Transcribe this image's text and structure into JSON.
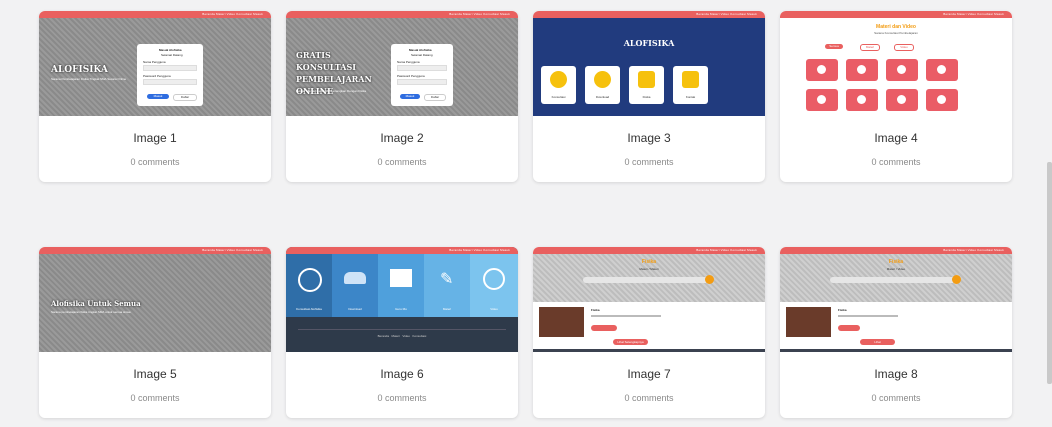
{
  "cards": [
    {
      "caption": "Image 1",
      "comments": "0 comments",
      "hero": "ALOFISIKA",
      "sub": "Sarana Pembelajaran Fisika Tingkat SMA Secara Online",
      "login_title": "Masuk Alofisika",
      "login_sub": "Selamat Datang",
      "field1": "Nama Pengguna",
      "field2": "Password Pengguna",
      "btn1": "Masuk",
      "btn2": "Daftar"
    },
    {
      "caption": "Image 2",
      "comments": "0 comments",
      "hero": "GRATIS KONSULTASI PEMBELAJARAN ONLINE",
      "sub": "Belajar Menjadi Lebih Menyenangkan Dengan Fisika",
      "login_title": "Masuk Alofisika",
      "login_sub": "Selamat Datang",
      "field1": "Nama Pengguna",
      "field2": "Password Pengguna",
      "btn1": "Masuk",
      "btn2": "Daftar"
    },
    {
      "caption": "Image 3",
      "comments": "0 comments",
      "hero": "ALOFISIKA",
      "tiles": [
        "Konsultasi",
        "Download",
        "Fisika",
        "Kontak"
      ]
    },
    {
      "caption": "Image 4",
      "comments": "0 comments",
      "title": "Materi dan Video",
      "sub": "Sarana Konsultasi Pembelajaran",
      "pills": [
        "Semua",
        "Materi",
        "Video"
      ]
    },
    {
      "caption": "Image 5",
      "comments": "0 comments",
      "hero": "Alofisika Untuk Semua",
      "sub": "Sarana pembelajaran fisika tingkat SMA untuk semua siswa"
    },
    {
      "caption": "Image 6",
      "comments": "0 comments",
      "tiles": [
        "Konsultasi Alofisika",
        "Download",
        "Guru Mu",
        "Materi",
        "Video"
      ],
      "footer": "Beranda   Materi   Video   Konsultasi"
    },
    {
      "caption": "Image 7",
      "comments": "0 comments",
      "title": "Fisika",
      "sub": "Materi / Materi",
      "post_title": "Fisika",
      "button": "Lihat Selengkapnya"
    },
    {
      "caption": "Image 8",
      "comments": "0 comments",
      "title": "Fisika",
      "sub": "Materi / Video",
      "post_title": "Fisika",
      "button": "Lihat"
    }
  ],
  "nav": "Beranda   Materi   Video   Konsultasi   Masuk"
}
